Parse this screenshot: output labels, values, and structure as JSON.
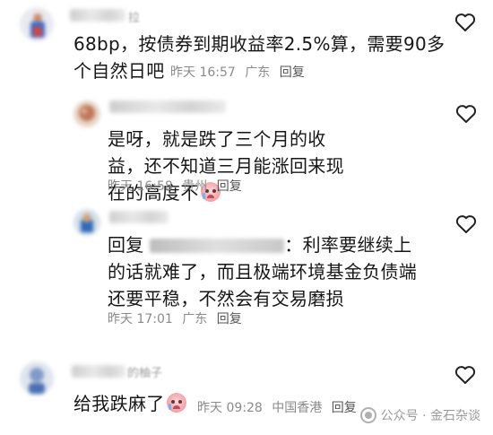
{
  "comments": [
    {
      "name_suffix": "拉",
      "text": "68bp，按债券到期收益率2.5%算，需要90多个自然日吧",
      "time": "昨天 16:57",
      "location": "广东",
      "reply": "回复"
    },
    {
      "text": "是呀，就是跌了三个月的收益，还不知道三月能涨回来现在的高度不",
      "time": "昨天 16:58",
      "location": "贵州",
      "reply": "回复"
    },
    {
      "reply_prefix": "回复",
      "reply_target_end": "：利率要继续上",
      "text_line2": "的话就难了，而且极端环境基金负债端",
      "text_line3": "还要平稳，不然会有交易磨损",
      "time": "昨天 17:01",
      "location": "广东",
      "reply": "回复"
    },
    {
      "name_suffix": "的柚子",
      "text": "给我跌麻了",
      "time": "昨天 09:28",
      "location": "中国香港",
      "reply": "回复"
    }
  ],
  "watermark": {
    "text": "公众号 · 金石杂谈"
  },
  "icons": {
    "like": "heart-outline-icon",
    "emoji": "crying-face-emoji",
    "watermark": "wechat-official-account-icon"
  },
  "colors": {
    "text": "#161616",
    "meta": "#8a8a8a",
    "icon": "#222222"
  }
}
